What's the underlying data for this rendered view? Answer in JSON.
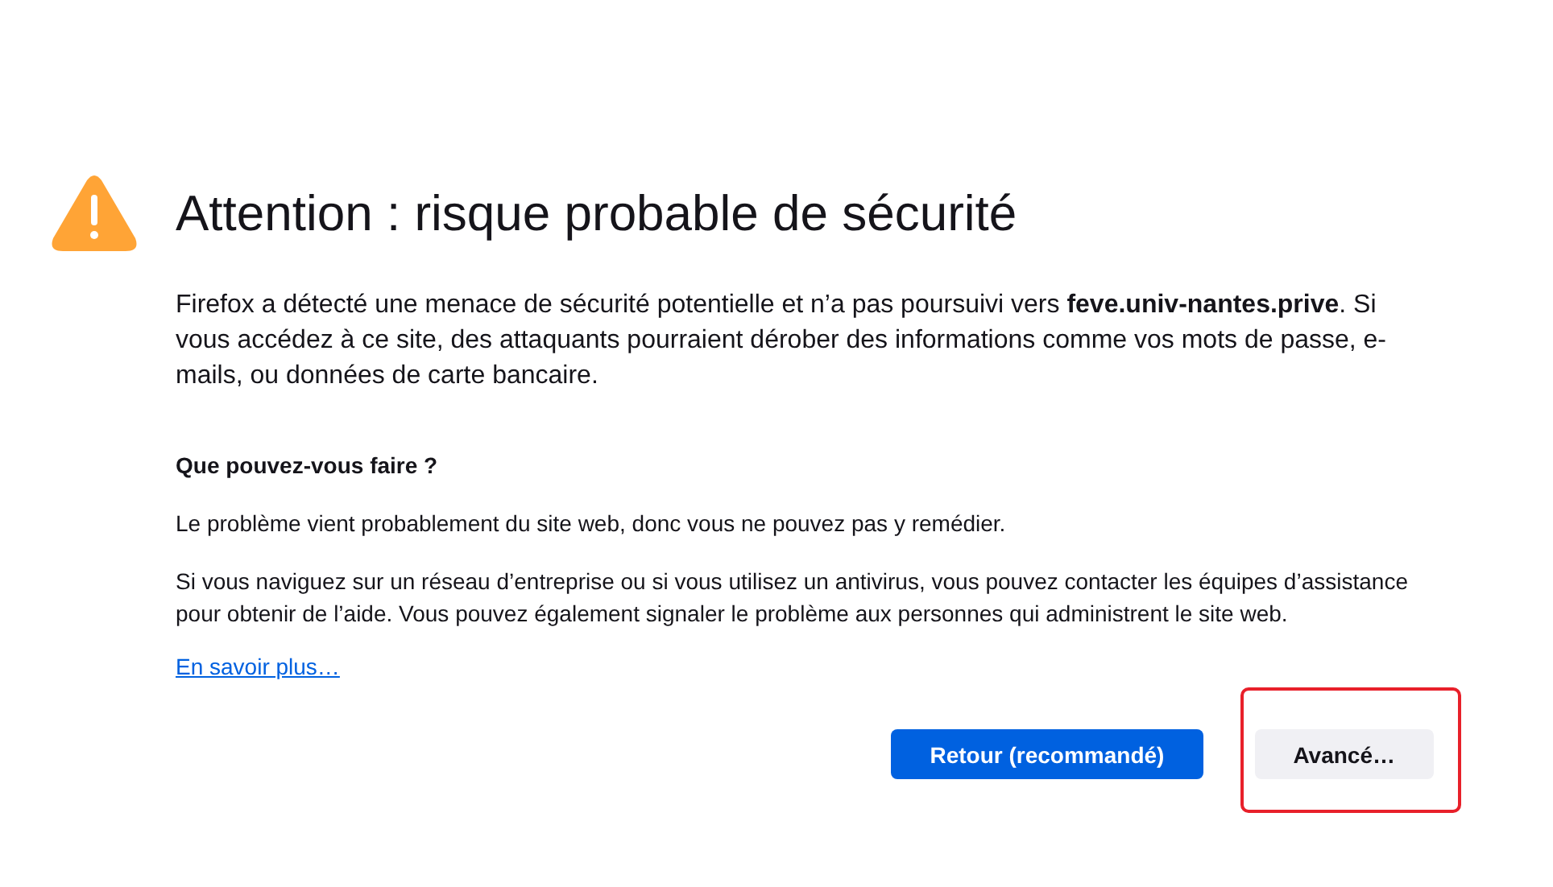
{
  "title": "Attention : risque probable de sécurité",
  "intro": "Firefox a détecté une menace de sécurité potentielle et n’a pas poursuivi vers **feve.univ-nantes.prive**. Si vous accédez à ce site, des attaquants pourraient dérober des informations comme vos mots de passe, e-mails, ou données de carte bancaire.",
  "section_heading": "Que pouvez-vous faire ?",
  "paragraphs": [
    "Le problème vient probablement du site web, donc vous ne pouvez pas y remédier.",
    "Si vous naviguez sur un réseau d’entreprise ou si vous utilisez un antivirus, vous pouvez contacter les équipes d’assistance pour obtenir de l’aide. Vous pouvez également signaler le problème aux personnes qui administrent le site web."
  ],
  "learn_more_link": "En savoir plus…",
  "buttons": [
    {
      "label": "Retour (recommandé)",
      "kind": "primary",
      "highlighted": false
    },
    {
      "label": "Avancé…",
      "kind": "secondary",
      "highlighted": true
    }
  ]
}
